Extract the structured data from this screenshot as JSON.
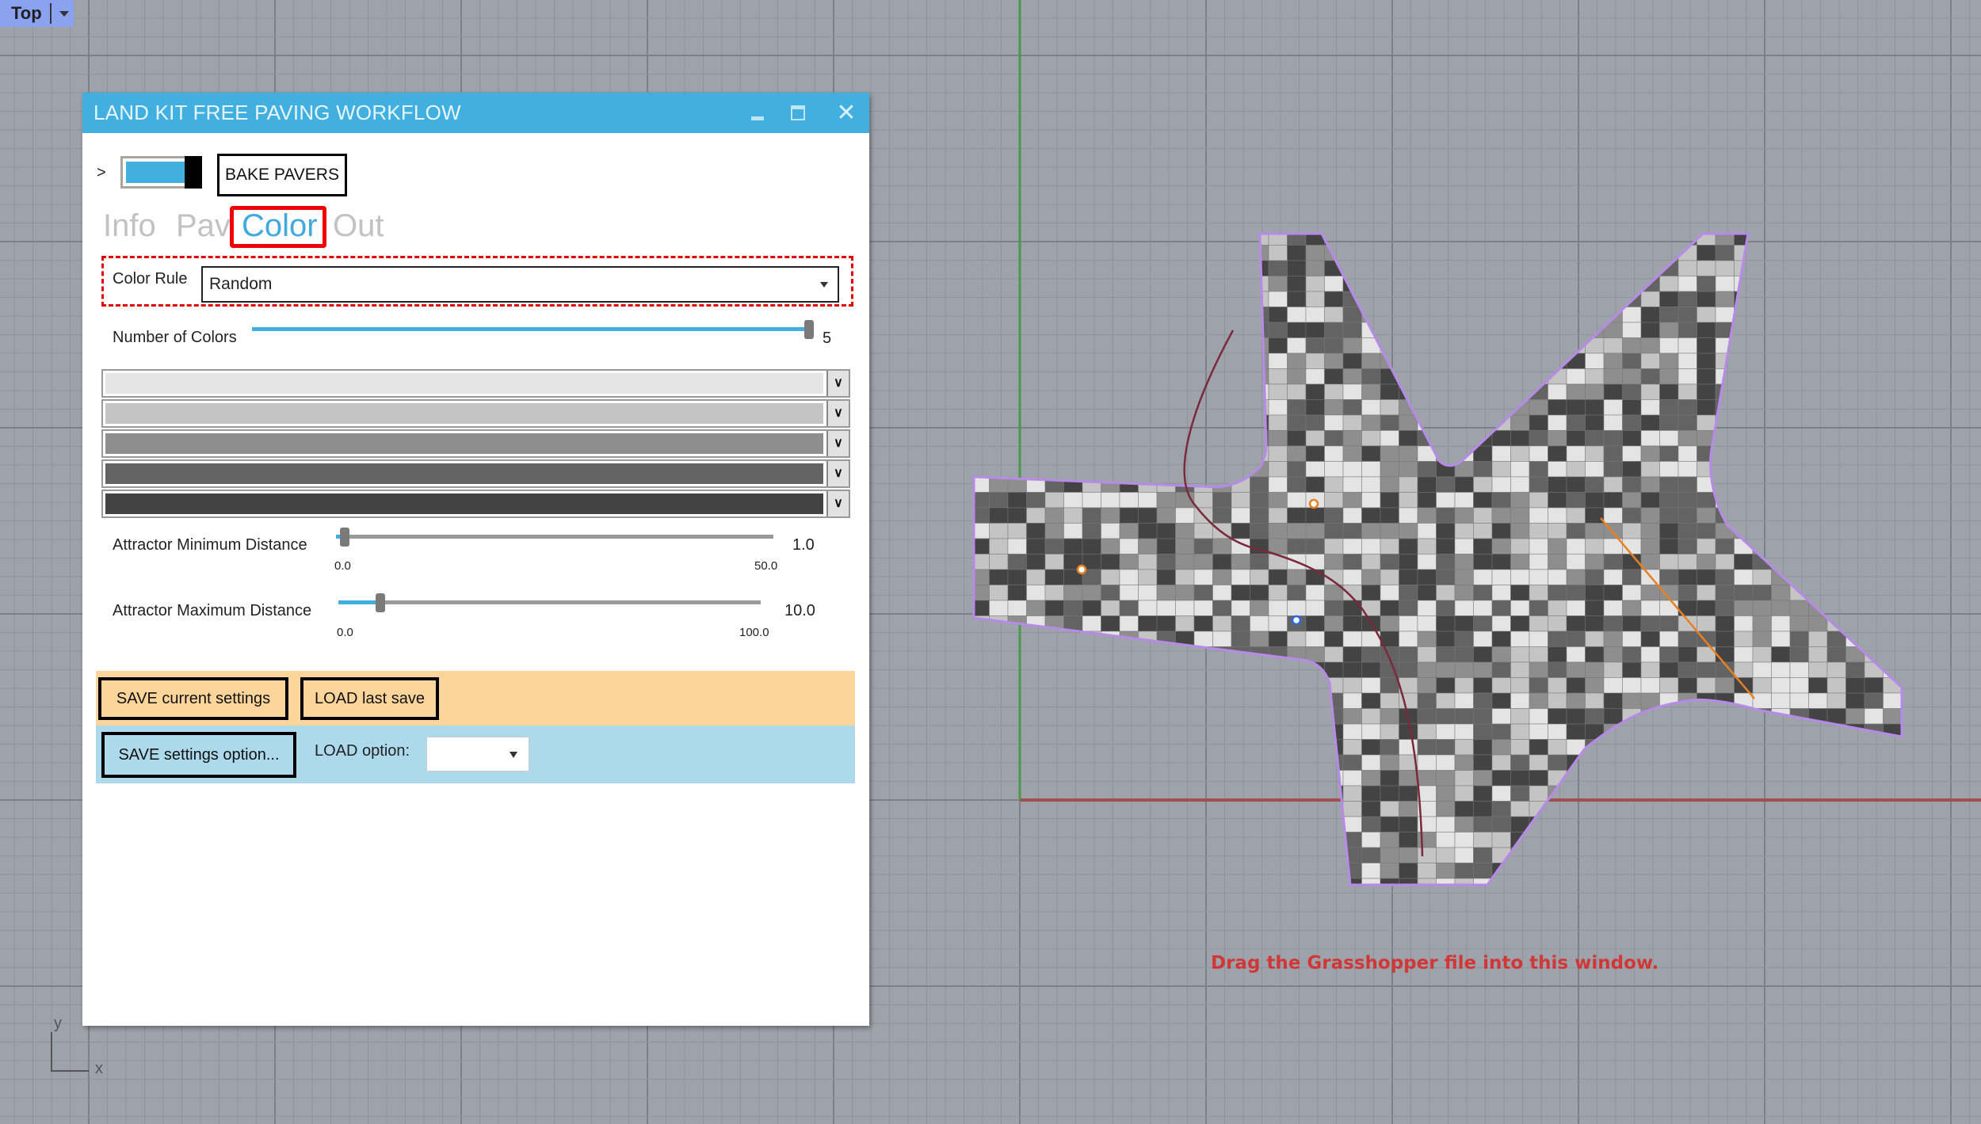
{
  "viewport": {
    "name": "Top",
    "hint_text": "Drag the Grasshopper file into this window.",
    "axis_labels": {
      "x": "x",
      "y": "y"
    },
    "colors": {
      "background": "#9ea3ab",
      "grid_minor": "#8f949c",
      "grid_major": "#7c8088",
      "x_axis": "#a05050",
      "y_axis": "#4a9a4a",
      "boundary": "#b88ae8",
      "curve": "#7a2a3a",
      "line": "#e88020",
      "hint": "#d03838"
    }
  },
  "panel": {
    "title": "LAND KIT FREE PAVING WORKFLOW",
    "window_controls": {
      "minimize": "minimize-icon",
      "maximize": "maximize-icon",
      "close": "✕"
    },
    "expander": ">",
    "toggle_on": true,
    "bake_button": "BAKE PAVERS",
    "tabs": [
      {
        "label": "Info",
        "active": false
      },
      {
        "label": "Pav",
        "active": false
      },
      {
        "label": "Color",
        "active": true
      },
      {
        "label": "Out",
        "active": false
      }
    ],
    "color_rule": {
      "label": "Color Rule",
      "value": "Random"
    },
    "number_of_colors": {
      "label": "Number of Colors",
      "value": "5",
      "min": 1,
      "max": 5,
      "fraction": 1.0
    },
    "swatches": [
      "#e4e4e4",
      "#c4c4c4",
      "#8e8e8e",
      "#636363",
      "#434343"
    ],
    "attractor_min": {
      "label": "Attractor Minimum Distance",
      "value": "1.0",
      "min_label": "0.0",
      "max_label": "50.0",
      "fraction": 0.02
    },
    "attractor_max": {
      "label": "Attractor Maximum Distance",
      "value": "10.0",
      "min_label": "0.0",
      "max_label": "100.0",
      "fraction": 0.1
    },
    "save_current": "SAVE current settings",
    "load_last": "LOAD last save",
    "save_option": "SAVE settings option...",
    "load_option_label": "LOAD option:",
    "load_option_value": "",
    "colors": {
      "accent": "#41b0e1",
      "tab_inactive": "#c2c2c2",
      "highlight": "#f00000",
      "band_orange": "#fdd59b",
      "band_blue": "#acd9ec"
    }
  }
}
